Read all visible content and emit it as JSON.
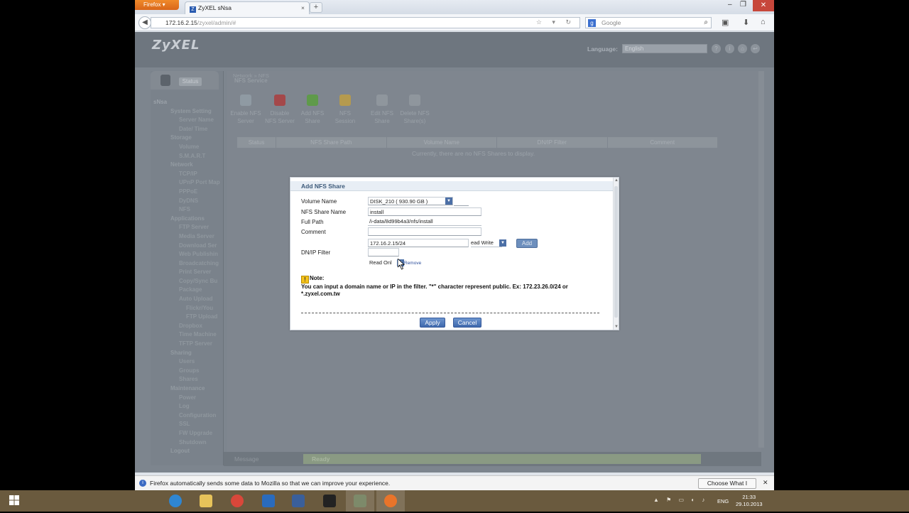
{
  "browser": {
    "app_button": "Firefox",
    "tab_title": "ZyXEL sNsa",
    "url_host": "172.16.2.15",
    "url_path": "/zyxel/admin/#",
    "search_placeholder": "Google"
  },
  "nas": {
    "logo": "ZyXEL",
    "language_label": "Language:",
    "language_value": "English",
    "status_tab": "Status",
    "breadcrumb": "Network » NFS",
    "section_title": "NFS Service",
    "tree": [
      {
        "level": "root",
        "label": "sNsa"
      },
      {
        "level": "l2",
        "label": "System Setting"
      },
      {
        "level": "l3",
        "label": "Server Name"
      },
      {
        "level": "l3",
        "label": "Date/ Time"
      },
      {
        "level": "l2",
        "label": "Storage"
      },
      {
        "level": "l3",
        "label": "Volume"
      },
      {
        "level": "l3",
        "label": "S.M.A.R.T"
      },
      {
        "level": "l2",
        "label": "Network"
      },
      {
        "level": "l3",
        "label": "TCP/IP"
      },
      {
        "level": "l3",
        "label": "UPnP Port Map"
      },
      {
        "level": "l3",
        "label": "PPPoE"
      },
      {
        "level": "l3",
        "label": "DyDNS"
      },
      {
        "level": "l3",
        "label": "NFS"
      },
      {
        "level": "l2",
        "label": "Applications"
      },
      {
        "level": "l3",
        "label": "FTP Server"
      },
      {
        "level": "l3",
        "label": "Media Server"
      },
      {
        "level": "l3",
        "label": "Download Ser"
      },
      {
        "level": "l3",
        "label": "Web Publishin"
      },
      {
        "level": "l3",
        "label": "Broadcatching"
      },
      {
        "level": "l3",
        "label": "Print Server"
      },
      {
        "level": "l3",
        "label": "Copy/Sync Bu"
      },
      {
        "level": "l3",
        "label": "Package"
      },
      {
        "level": "l3",
        "label": "Auto Upload"
      },
      {
        "level": "l4",
        "label": "Flickr/You"
      },
      {
        "level": "l4",
        "label": "FTP Upload"
      },
      {
        "level": "l3",
        "label": "Dropbox"
      },
      {
        "level": "l3",
        "label": "Time Machine"
      },
      {
        "level": "l3",
        "label": "TFTP Server"
      },
      {
        "level": "l2",
        "label": "Sharing"
      },
      {
        "level": "l3",
        "label": "Users"
      },
      {
        "level": "l3",
        "label": "Groups"
      },
      {
        "level": "l3",
        "label": "Shares"
      },
      {
        "level": "l2",
        "label": "Maintenance"
      },
      {
        "level": "l3",
        "label": "Power"
      },
      {
        "level": "l3",
        "label": "Log"
      },
      {
        "level": "l3",
        "label": "Configuration"
      },
      {
        "level": "l3",
        "label": "SSL"
      },
      {
        "level": "l3",
        "label": "FW Upgrade"
      },
      {
        "level": "l3",
        "label": "Shutdown"
      },
      {
        "level": "l2",
        "label": "Logout"
      }
    ],
    "toolbar": [
      {
        "label": "Enable NFS Server",
        "color": "#8f9aa3"
      },
      {
        "label": "Disable NFS Server",
        "color": "#a4484a"
      },
      {
        "label": "Add NFS Share",
        "color": "#5f9a4a"
      },
      {
        "label": "NFS Session",
        "color": "#b59a4e"
      },
      {
        "label": "Edit NFS Share",
        "color": "#8f969d"
      },
      {
        "label": "Delete NFS Share(s)",
        "color": "#8f969d"
      }
    ],
    "table_headers": [
      "Status",
      "NFS Share Path",
      "Volume Name",
      "DN/IP Filter",
      "Comment"
    ],
    "empty_message": "Currently, there are no NFS Shares to display.",
    "message_label": "Message",
    "message_value": "Ready"
  },
  "dialog": {
    "title": "Add NFS Share",
    "volume_label": "Volume Name",
    "volume_value": "DISK_210 ( 930.90 GB )",
    "share_name_label": "NFS Share Name",
    "share_name_value": "install",
    "full_path_label": "Full Path",
    "full_path_value": "/i-data/8d99b4a3/nfs/install",
    "comment_label": "Comment",
    "comment_value": "",
    "filter_label": "DN/IP Filter",
    "filter_input_value": "172.16.2.15/24",
    "filter_perm_value": "ead Write",
    "add_button": "Add",
    "filter_row_value": "",
    "filter_row_perm": "Read Onl",
    "remove_link": "Remove",
    "note_title": "Note:",
    "note_text": "You can input a domain name or IP in the filter. \"*\" character represent public. Ex: 172.23.26.0/24 or *.zyxel.com.tw",
    "apply_button": "Apply",
    "cancel_button": "Cancel"
  },
  "notification": {
    "text": "Firefox automatically sends some data to Mozilla so that we can improve your experience.",
    "button": "Choose What I Share"
  },
  "taskbar": {
    "lang": "ENG",
    "time": "21:33",
    "date": "29.10.2013",
    "apps": [
      {
        "name": "ie-icon",
        "color": "#2f86d1"
      },
      {
        "name": "explorer-icon",
        "color": "#e7c35a"
      },
      {
        "name": "chrome-icon",
        "color": "#d9473a"
      },
      {
        "name": "outlook-icon",
        "color": "#2a6bbd"
      },
      {
        "name": "remote-desktop-icon",
        "color": "#3a5f9a"
      },
      {
        "name": "terminal-icon",
        "color": "#222222"
      },
      {
        "name": "network-tool-icon",
        "color": "#7d8a6a"
      },
      {
        "name": "firefox-icon",
        "color": "#e9742a"
      }
    ]
  }
}
